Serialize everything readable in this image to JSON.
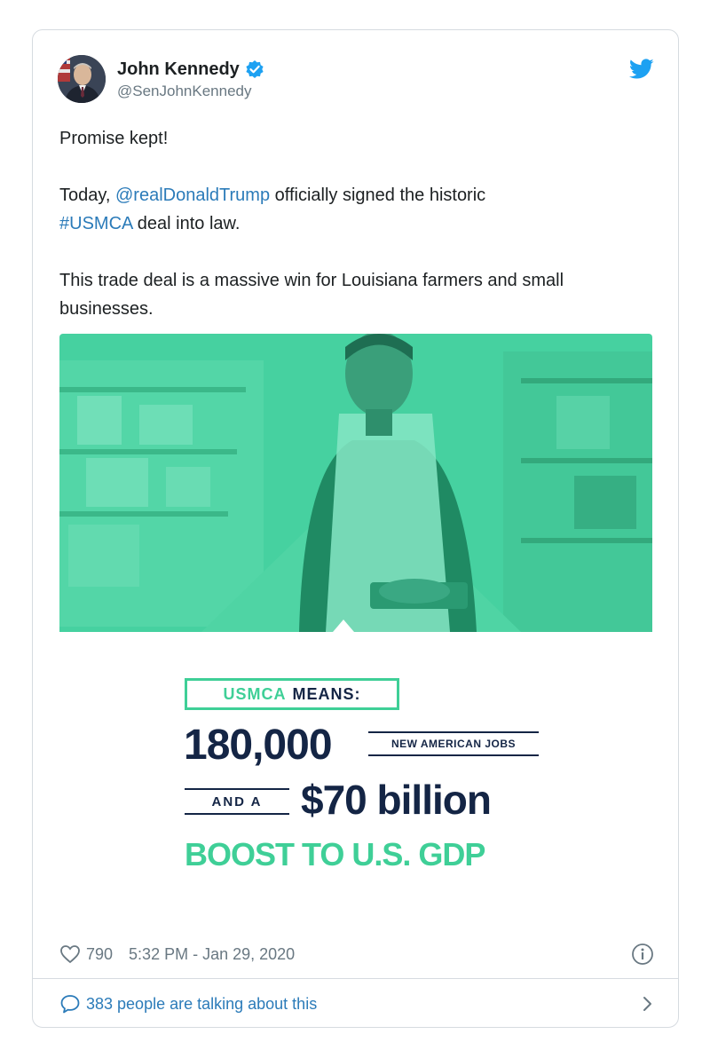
{
  "tweet": {
    "author": {
      "name": "John Kennedy",
      "handle": "@SenJohnKennedy",
      "verified": true
    },
    "text": {
      "line1": "Promise kept!",
      "p2_prefix": "Today, ",
      "mention": "@realDonaldTrump",
      "p2_mid": " officially signed the historic",
      "hashtag": "#USMCA",
      "p2_suffix": " deal into law.",
      "p3": "This trade deal is a massive win for Louisiana farmers and small businesses."
    },
    "infographic": {
      "label_green": "USMCA",
      "label_dark": "MEANS:",
      "figure1": "180,000",
      "figure1_caption": "NEW AMERICAN JOBS",
      "connector": "AND A",
      "figure2": "$70 billion",
      "tagline": "BOOST TO U.S. GDP"
    },
    "likes": "790",
    "timestamp": "5:32 PM - Jan 29, 2020",
    "conversation": "383 people are talking about this"
  },
  "icons": {
    "verified": "verified-badge-icon",
    "brand": "twitter-bird-icon",
    "like": "heart-icon",
    "info": "info-icon",
    "reply": "speech-bubble-icon",
    "open": "chevron-right-icon"
  },
  "colors": {
    "link": "#2b7bb9",
    "verified": "#1da1f2",
    "infographic_green": "#3fcf97",
    "infographic_navy": "#142545",
    "meta_gray": "#697882"
  }
}
